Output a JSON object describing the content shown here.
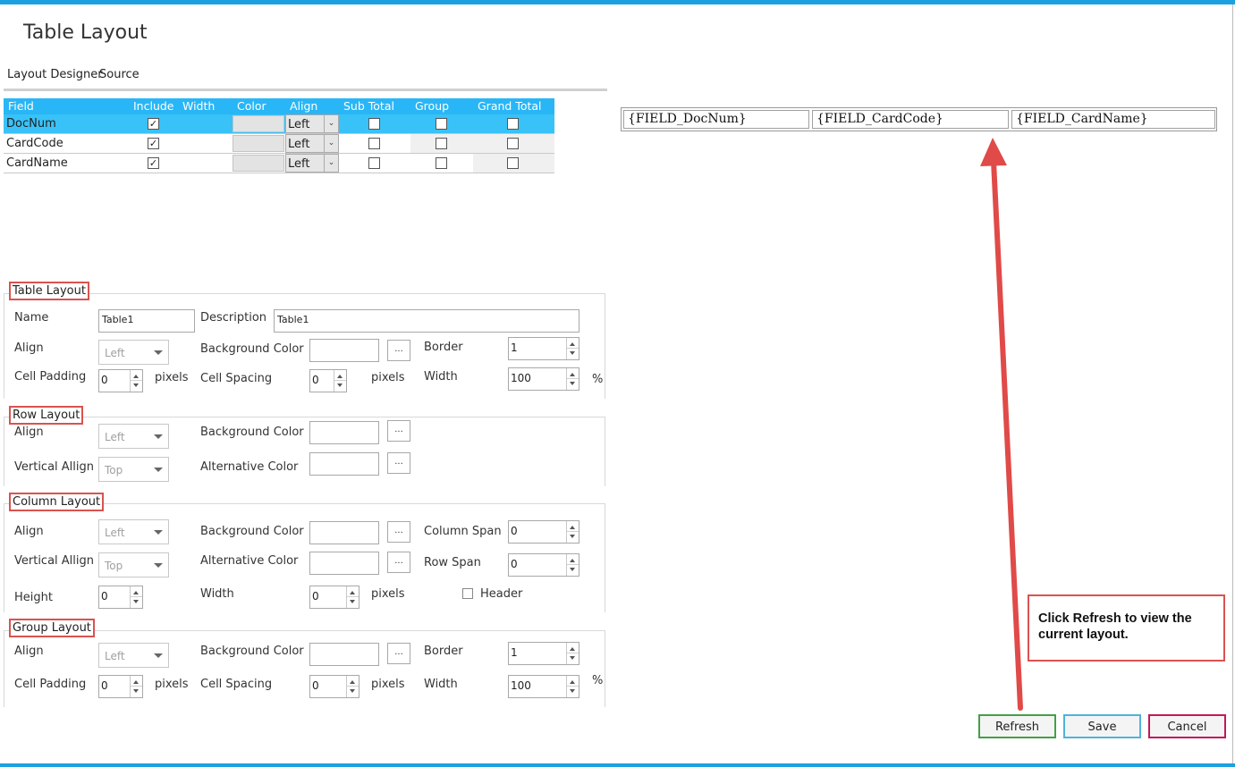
{
  "window": {
    "title": "Table Layout"
  },
  "tabs": [
    {
      "label": "Layout Designer"
    },
    {
      "label": "Source"
    }
  ],
  "grid": {
    "headers": {
      "field": "Field",
      "include": "Include",
      "width": "Width",
      "color": "Color",
      "align": "Align",
      "sub_total": "Sub Total",
      "group": "Group",
      "grand_total": "Grand Total"
    },
    "rows": [
      {
        "field": "DocNum",
        "include": "✓",
        "align": "Left",
        "selected": true
      },
      {
        "field": "CardCode",
        "include": "✓",
        "align": "Left",
        "selected": false
      },
      {
        "field": "CardName",
        "include": "✓",
        "align": "Left",
        "selected": false
      }
    ]
  },
  "table_layout": {
    "legend": "Table Layout",
    "name_label": "Name",
    "name_value": "Table1",
    "description_label": "Description",
    "description_value": "Table1",
    "align_label": "Align",
    "align_value": "Left",
    "background_color_label": "Background Color",
    "border_label": "Border",
    "border_value": "1",
    "cell_padding_label": "Cell Padding",
    "cell_padding_value": "0",
    "cell_padding_unit": "pixels",
    "cell_spacing_label": "Cell Spacing",
    "cell_spacing_value": "0",
    "cell_spacing_unit": "pixels",
    "width_label": "Width",
    "width_value": "100",
    "width_unit": "%"
  },
  "row_layout": {
    "legend": "Row Layout",
    "align_label": "Align",
    "align_value": "Left",
    "background_color_label": "Background Color",
    "vertical_align_label": "Vertical Allign",
    "vertical_align_value": "Top",
    "alternative_color_label": "Alternative Color"
  },
  "column_layout": {
    "legend": "Column Layout",
    "align_label": "Align",
    "align_value": "Left",
    "background_color_label": "Background Color",
    "column_span_label": "Column Span",
    "column_span_value": "0",
    "vertical_align_label": "Vertical Allign",
    "vertical_align_value": "Top",
    "alternative_color_label": "Alternative Color",
    "row_span_label": "Row Span",
    "row_span_value": "0",
    "height_label": "Height",
    "height_value": "0",
    "width_label": "Width",
    "width_value": "0",
    "width_unit": "pixels",
    "header_label": "Header"
  },
  "group_layout": {
    "legend": "Group Layout",
    "align_label": "Align",
    "align_value": "Left",
    "background_color_label": "Background Color",
    "border_label": "Border",
    "border_value": "1",
    "cell_padding_label": "Cell Padding",
    "cell_padding_value": "0",
    "cell_padding_unit": "pixels",
    "cell_spacing_label": "Cell Spacing",
    "cell_spacing_value": "0",
    "cell_spacing_unit": "pixels",
    "width_label": "Width",
    "width_value": "100",
    "width_unit": "%"
  },
  "browse_button_label": "...",
  "preview": {
    "cells": [
      "{FIELD_DocNum}",
      "{FIELD_CardCode}",
      "{FIELD_CardName}"
    ]
  },
  "callout": {
    "text": "Click Refresh to view the current layout."
  },
  "buttons": {
    "refresh": "Refresh",
    "save": "Save",
    "cancel": "Cancel"
  },
  "colors": {
    "accent": "#1ba1e2",
    "header_blue": "#29b6f6",
    "selected_row": "#39c2f7",
    "callout_red": "#d9534f",
    "refresh_border": "#43a047",
    "save_border": "#4fb3d9",
    "cancel_border": "#c2185b"
  }
}
